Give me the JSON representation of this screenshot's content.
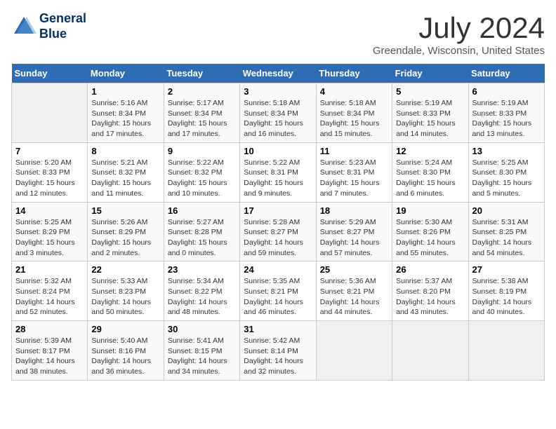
{
  "header": {
    "logo_line1": "General",
    "logo_line2": "Blue",
    "month_title": "July 2024",
    "location": "Greendale, Wisconsin, United States"
  },
  "days_of_week": [
    "Sunday",
    "Monday",
    "Tuesday",
    "Wednesday",
    "Thursday",
    "Friday",
    "Saturday"
  ],
  "weeks": [
    [
      {
        "day": "",
        "info": ""
      },
      {
        "day": "1",
        "info": "Sunrise: 5:16 AM\nSunset: 8:34 PM\nDaylight: 15 hours\nand 17 minutes."
      },
      {
        "day": "2",
        "info": "Sunrise: 5:17 AM\nSunset: 8:34 PM\nDaylight: 15 hours\nand 17 minutes."
      },
      {
        "day": "3",
        "info": "Sunrise: 5:18 AM\nSunset: 8:34 PM\nDaylight: 15 hours\nand 16 minutes."
      },
      {
        "day": "4",
        "info": "Sunrise: 5:18 AM\nSunset: 8:34 PM\nDaylight: 15 hours\nand 15 minutes."
      },
      {
        "day": "5",
        "info": "Sunrise: 5:19 AM\nSunset: 8:33 PM\nDaylight: 15 hours\nand 14 minutes."
      },
      {
        "day": "6",
        "info": "Sunrise: 5:19 AM\nSunset: 8:33 PM\nDaylight: 15 hours\nand 13 minutes."
      }
    ],
    [
      {
        "day": "7",
        "info": "Sunrise: 5:20 AM\nSunset: 8:33 PM\nDaylight: 15 hours\nand 12 minutes."
      },
      {
        "day": "8",
        "info": "Sunrise: 5:21 AM\nSunset: 8:32 PM\nDaylight: 15 hours\nand 11 minutes."
      },
      {
        "day": "9",
        "info": "Sunrise: 5:22 AM\nSunset: 8:32 PM\nDaylight: 15 hours\nand 10 minutes."
      },
      {
        "day": "10",
        "info": "Sunrise: 5:22 AM\nSunset: 8:31 PM\nDaylight: 15 hours\nand 9 minutes."
      },
      {
        "day": "11",
        "info": "Sunrise: 5:23 AM\nSunset: 8:31 PM\nDaylight: 15 hours\nand 7 minutes."
      },
      {
        "day": "12",
        "info": "Sunrise: 5:24 AM\nSunset: 8:30 PM\nDaylight: 15 hours\nand 6 minutes."
      },
      {
        "day": "13",
        "info": "Sunrise: 5:25 AM\nSunset: 8:30 PM\nDaylight: 15 hours\nand 5 minutes."
      }
    ],
    [
      {
        "day": "14",
        "info": "Sunrise: 5:25 AM\nSunset: 8:29 PM\nDaylight: 15 hours\nand 3 minutes."
      },
      {
        "day": "15",
        "info": "Sunrise: 5:26 AM\nSunset: 8:29 PM\nDaylight: 15 hours\nand 2 minutes."
      },
      {
        "day": "16",
        "info": "Sunrise: 5:27 AM\nSunset: 8:28 PM\nDaylight: 15 hours\nand 0 minutes."
      },
      {
        "day": "17",
        "info": "Sunrise: 5:28 AM\nSunset: 8:27 PM\nDaylight: 14 hours\nand 59 minutes."
      },
      {
        "day": "18",
        "info": "Sunrise: 5:29 AM\nSunset: 8:27 PM\nDaylight: 14 hours\nand 57 minutes."
      },
      {
        "day": "19",
        "info": "Sunrise: 5:30 AM\nSunset: 8:26 PM\nDaylight: 14 hours\nand 55 minutes."
      },
      {
        "day": "20",
        "info": "Sunrise: 5:31 AM\nSunset: 8:25 PM\nDaylight: 14 hours\nand 54 minutes."
      }
    ],
    [
      {
        "day": "21",
        "info": "Sunrise: 5:32 AM\nSunset: 8:24 PM\nDaylight: 14 hours\nand 52 minutes."
      },
      {
        "day": "22",
        "info": "Sunrise: 5:33 AM\nSunset: 8:23 PM\nDaylight: 14 hours\nand 50 minutes."
      },
      {
        "day": "23",
        "info": "Sunrise: 5:34 AM\nSunset: 8:22 PM\nDaylight: 14 hours\nand 48 minutes."
      },
      {
        "day": "24",
        "info": "Sunrise: 5:35 AM\nSunset: 8:21 PM\nDaylight: 14 hours\nand 46 minutes."
      },
      {
        "day": "25",
        "info": "Sunrise: 5:36 AM\nSunset: 8:21 PM\nDaylight: 14 hours\nand 44 minutes."
      },
      {
        "day": "26",
        "info": "Sunrise: 5:37 AM\nSunset: 8:20 PM\nDaylight: 14 hours\nand 43 minutes."
      },
      {
        "day": "27",
        "info": "Sunrise: 5:38 AM\nSunset: 8:19 PM\nDaylight: 14 hours\nand 40 minutes."
      }
    ],
    [
      {
        "day": "28",
        "info": "Sunrise: 5:39 AM\nSunset: 8:17 PM\nDaylight: 14 hours\nand 38 minutes."
      },
      {
        "day": "29",
        "info": "Sunrise: 5:40 AM\nSunset: 8:16 PM\nDaylight: 14 hours\nand 36 minutes."
      },
      {
        "day": "30",
        "info": "Sunrise: 5:41 AM\nSunset: 8:15 PM\nDaylight: 14 hours\nand 34 minutes."
      },
      {
        "day": "31",
        "info": "Sunrise: 5:42 AM\nSunset: 8:14 PM\nDaylight: 14 hours\nand 32 minutes."
      },
      {
        "day": "",
        "info": ""
      },
      {
        "day": "",
        "info": ""
      },
      {
        "day": "",
        "info": ""
      }
    ]
  ]
}
